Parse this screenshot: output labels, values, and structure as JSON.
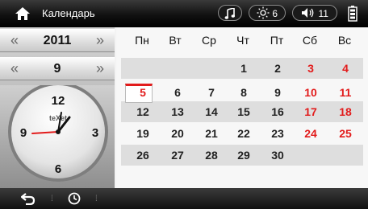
{
  "header": {
    "title": "Календарь",
    "brightness": "6",
    "volume": "11"
  },
  "year": {
    "value": "2011",
    "prev": "«",
    "next": "»"
  },
  "month": {
    "value": "9",
    "prev": "«",
    "next": "»"
  },
  "clock": {
    "brand": "teXet",
    "n12": "12",
    "n3": "3",
    "n6": "6",
    "n9": "9"
  },
  "calendar": {
    "weekdays": [
      "Пн",
      "Вт",
      "Ср",
      "Чт",
      "Пт",
      "Сб",
      "Вс"
    ],
    "rows": [
      [
        "",
        "",
        "",
        "1",
        "2",
        "3",
        "4"
      ],
      [
        "5",
        "6",
        "7",
        "8",
        "9",
        "10",
        "11"
      ],
      [
        "12",
        "13",
        "14",
        "15",
        "16",
        "17",
        "18"
      ],
      [
        "19",
        "20",
        "21",
        "22",
        "23",
        "24",
        "25"
      ],
      [
        "26",
        "27",
        "28",
        "29",
        "30",
        "",
        ""
      ]
    ],
    "today": "5"
  },
  "colors": {
    "accent": "#e21b1b",
    "bar": "#111111"
  },
  "icons": [
    "home-icon",
    "music-icon",
    "brightness-icon",
    "volume-icon",
    "battery-icon",
    "back-icon",
    "clock-icon"
  ]
}
